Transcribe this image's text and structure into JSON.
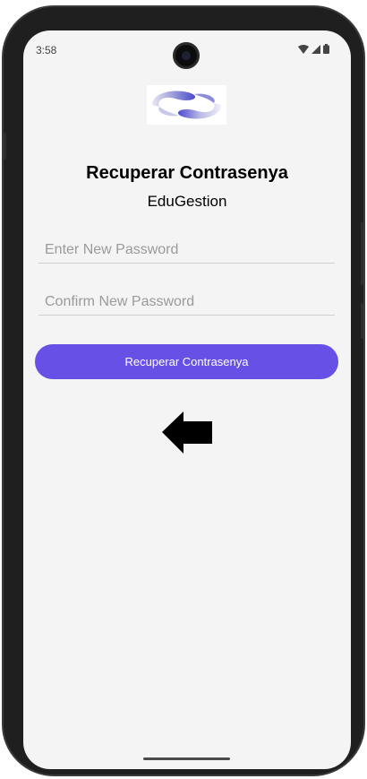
{
  "status_bar": {
    "time": "3:58",
    "icons": [
      "wifi-icon",
      "signal-icon",
      "battery-icon"
    ]
  },
  "logo": {
    "icon": "edugestion-logo"
  },
  "header": {
    "title": "Recuperar Contrasenya",
    "subtitle": "EduGestion"
  },
  "form": {
    "new_password": {
      "placeholder": "Enter New Password",
      "value": ""
    },
    "confirm_password": {
      "placeholder": "Confirm New Password",
      "value": ""
    },
    "submit_label": "Recuperar Contrasenya"
  },
  "nav": {
    "back_icon": "arrow-left-icon"
  },
  "colors": {
    "accent": "#6750e6",
    "background": "#f4f4f4",
    "text": "#000000"
  }
}
